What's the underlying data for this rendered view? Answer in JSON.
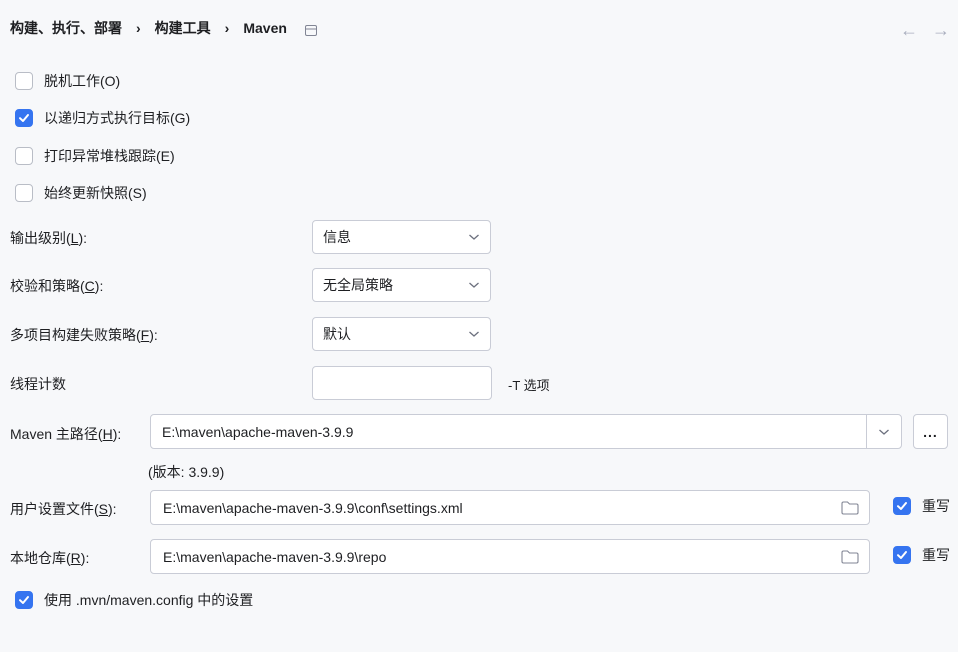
{
  "breadcrumb": {
    "item1": "构建、执行、部署",
    "item2": "构建工具",
    "item3": "Maven",
    "separator": "›"
  },
  "nav": {
    "back": "←",
    "forward": "→"
  },
  "options": {
    "offline": {
      "label": "脱机工作(O)",
      "checked": false
    },
    "recursive": {
      "label": "以递归方式执行目标(G)",
      "checked": true
    },
    "print_stack": {
      "label": "打印异常堆栈跟踪(E)",
      "checked": false
    },
    "always_update": {
      "label": "始终更新快照(S)",
      "checked": false
    }
  },
  "output_level": {
    "label_pre": "输出级别(",
    "label_key": "L",
    "label_post": "):",
    "value": "信息"
  },
  "checksum_policy": {
    "label_pre": "校验和策略(",
    "label_key": "C",
    "label_post": "):",
    "value": "无全局策略"
  },
  "multiproject_policy": {
    "label_pre": "多项目构建失败策略(",
    "label_key": "F",
    "label_post": "):",
    "value": "默认"
  },
  "thread_count": {
    "label": "线程计数",
    "value": "",
    "hint": "-T 选项"
  },
  "maven_home": {
    "label_pre": "Maven 主路径(",
    "label_key": "H",
    "label_post": "):",
    "value": "E:\\maven\\apache-maven-3.9.9",
    "browse": "...",
    "version": "(版本: 3.9.9)"
  },
  "user_settings": {
    "label_pre": "用户设置文件(",
    "label_key": "S",
    "label_post": "):",
    "value": "E:\\maven\\apache-maven-3.9.9\\conf\\settings.xml",
    "override_label": "重写",
    "override_checked": true
  },
  "local_repo": {
    "label_pre": "本地仓库(",
    "label_key": "R",
    "label_post": "):",
    "value": "E:\\maven\\apache-maven-3.9.9\\repo",
    "override_label": "重写",
    "override_checked": true
  },
  "use_mvn_config": {
    "label": "使用 .mvn/maven.config 中的设置",
    "checked": true
  },
  "colors": {
    "accent": "#3574f0",
    "background": "#f7f8fa",
    "border": "#c9ccd6"
  },
  "icons": {
    "pin": "window-pin-icon",
    "folder": "folder-icon",
    "chevron": "chevron-down-icon"
  }
}
